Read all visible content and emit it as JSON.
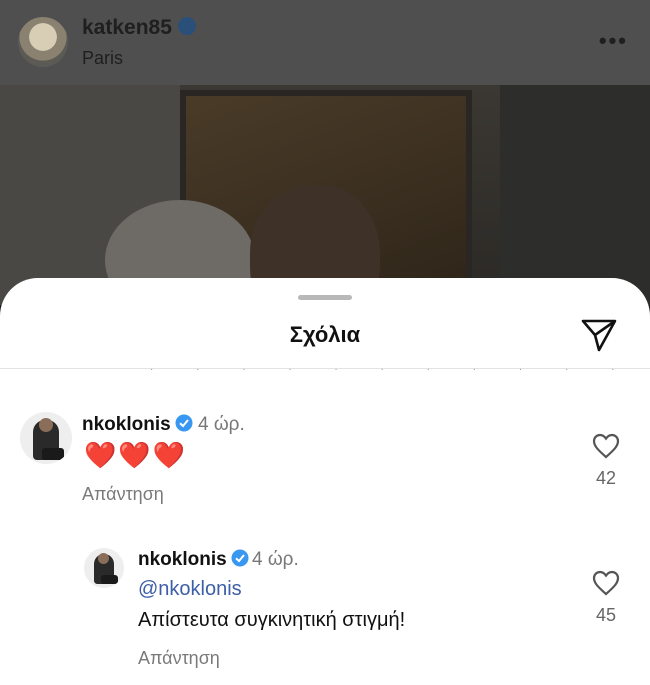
{
  "post": {
    "username": "katken85",
    "location": "Paris",
    "more_icon": "more-icon"
  },
  "sheet": {
    "title": "Σχόλια",
    "send_icon": "send-icon"
  },
  "comments": [
    {
      "username": "nkoklonis",
      "verified": true,
      "time": "4 ώρ.",
      "text": "❤️❤️❤️",
      "reply_label": "Απάντηση",
      "likes": "42"
    },
    {
      "username": "nkoklonis",
      "verified": true,
      "time": "4 ώρ.",
      "mention": "@nkoklonis",
      "text": "Απίστευτα συγκινητική στιγμή!",
      "reply_label": "Απάντηση",
      "likes": "45"
    }
  ],
  "colors": {
    "verified": "#3897f0",
    "heart": "#e2182b",
    "mention": "#3d5fa8"
  }
}
